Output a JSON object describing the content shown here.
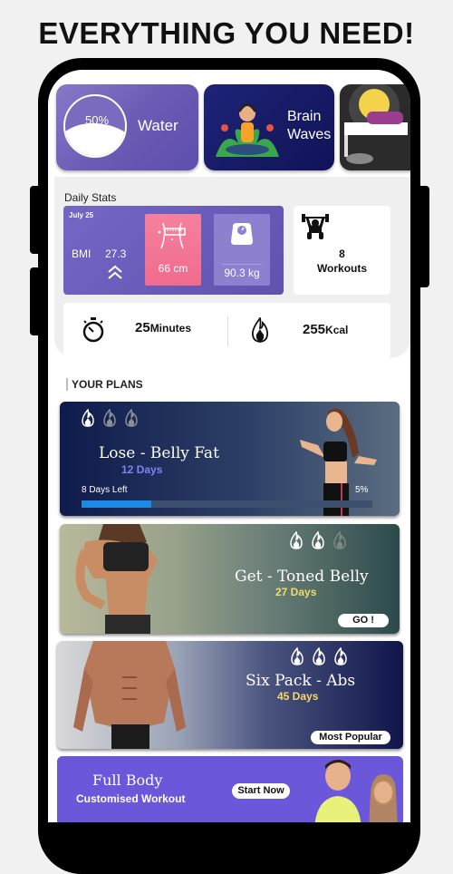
{
  "headline": "EVERYTHING YOU NEED!",
  "top_cards": {
    "water": {
      "percent": "50%",
      "label": "Water",
      "fill_fraction": 0.5
    },
    "brain": {
      "label_line1": "Brain",
      "label_line2": "Waves"
    },
    "sleep": {
      "icon": "sleeping-moon-illustration"
    }
  },
  "daily_stats": {
    "title": "Daily Stats",
    "date": "July 25",
    "bmi_label": "BMI",
    "bmi_value": "27.3",
    "bmi_trend_icon": "double-chevron-up",
    "waist": "66 cm",
    "weight": "90.3 kg",
    "workouts_count": "8",
    "workouts_label": "Workouts",
    "minutes_value": "25",
    "minutes_unit": "Minutes",
    "kcal_value": "255",
    "kcal_unit": "Kcal"
  },
  "plans": {
    "title": "YOUR PLANS",
    "items": [
      {
        "title": "Lose - Belly Fat",
        "days": "12 Days",
        "days_color": "#7d83f0",
        "intensity": 1,
        "left_text": "8 Days Left",
        "progress_text": "5%",
        "progress": 0.24
      },
      {
        "title": "Get - Toned Belly",
        "days": "27 Days",
        "days_color": "#f5d96b",
        "intensity": 2,
        "badge": "GO !"
      },
      {
        "title": "Six Pack - Abs",
        "days": "45 Days",
        "days_color": "#f5d96b",
        "intensity": 3,
        "badge": "Most Popular"
      }
    ],
    "full_body": {
      "title": "Full Body",
      "subtitle": "Customised Workout",
      "button": "Start Now"
    }
  },
  "colors": {
    "accent_purple": "#6b5bb4",
    "pink": "#f06b8d",
    "progress_blue": "#1e88e5"
  }
}
